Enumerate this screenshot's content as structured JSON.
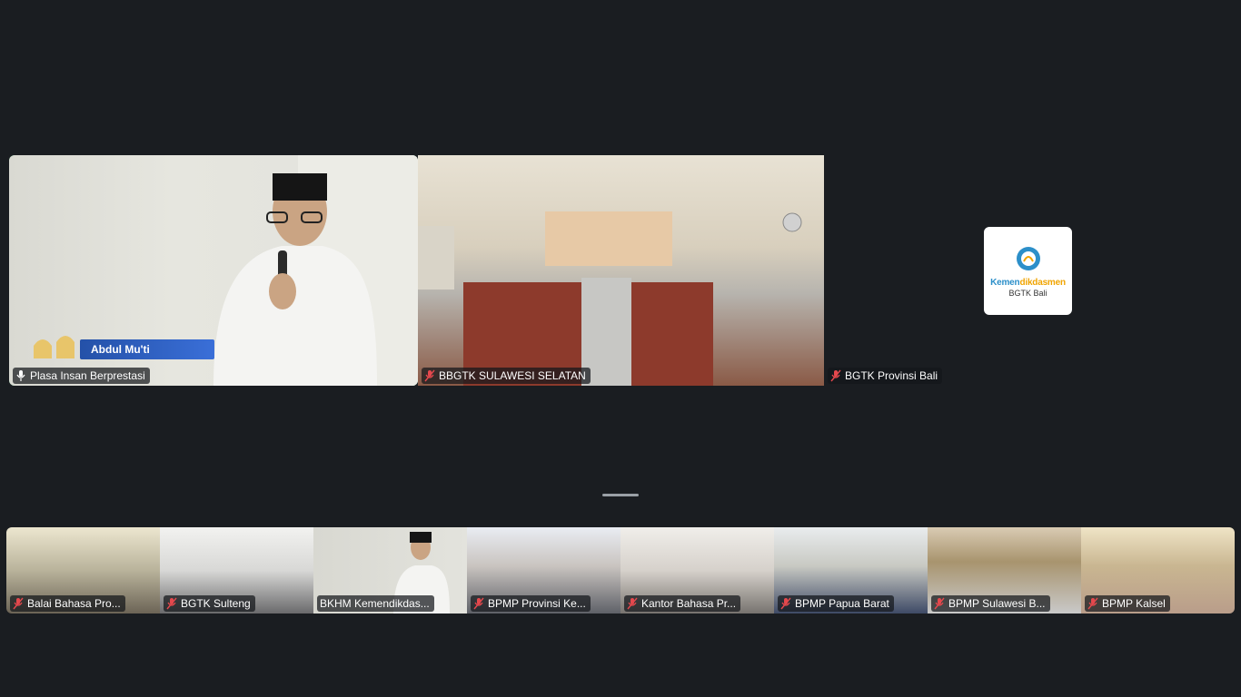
{
  "main_stage": {
    "tiles": [
      {
        "name": "Plasa Insan Berprestasi",
        "muted": false,
        "overlay_name": "Abdul Mu'ti"
      },
      {
        "name": "BBGTK SULAWESI SELATAN",
        "muted": true
      },
      {
        "name": "BGTK Provinsi Bali",
        "muted": true,
        "logo_brand_a": "Kemen",
        "logo_brand_b": "dikdasmen",
        "logo_sub": "BGTK Bali"
      }
    ]
  },
  "filmstrip": [
    {
      "name": "Balai Bahasa Pro...",
      "muted": true
    },
    {
      "name": "BGTK Sulteng",
      "muted": true
    },
    {
      "name": "BKHM Kemendikdas...",
      "muted": false
    },
    {
      "name": "BPMP Provinsi Ke...",
      "muted": true
    },
    {
      "name": "Kantor Bahasa Pr...",
      "muted": true
    },
    {
      "name": "BPMP Papua Barat",
      "muted": true
    },
    {
      "name": "BPMP Sulawesi B...",
      "muted": true
    },
    {
      "name": "BPMP Kalsel",
      "muted": true
    }
  ],
  "colors": {
    "background": "#1a1d21",
    "active_speaker": "#2ecc71",
    "muted_icon": "#e5484d"
  }
}
